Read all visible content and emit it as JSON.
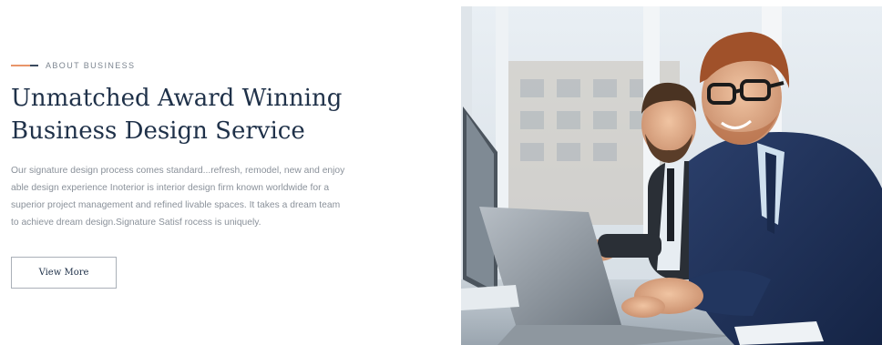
{
  "section": {
    "eyebrow": "ABOUT BUSINESS",
    "heading_lines": [
      "Unmatched Award Winning",
      "Business Design Service"
    ],
    "body_lines": [
      "Our signature design process comes standard...refresh, remodel, new and enjoy",
      "able design experience Inoterior is interior design firm known worldwide for a",
      "superior project management and refined livable spaces. It takes a dream team",
      "to achieve dream design.Signature Satisf rocess is uniquely."
    ],
    "button_label": "View More"
  },
  "colors": {
    "accent": "#e8956a",
    "heading": "#1f3149",
    "body": "#8a919a"
  },
  "photo": {
    "subject": "two-businessmen-at-laptop"
  }
}
